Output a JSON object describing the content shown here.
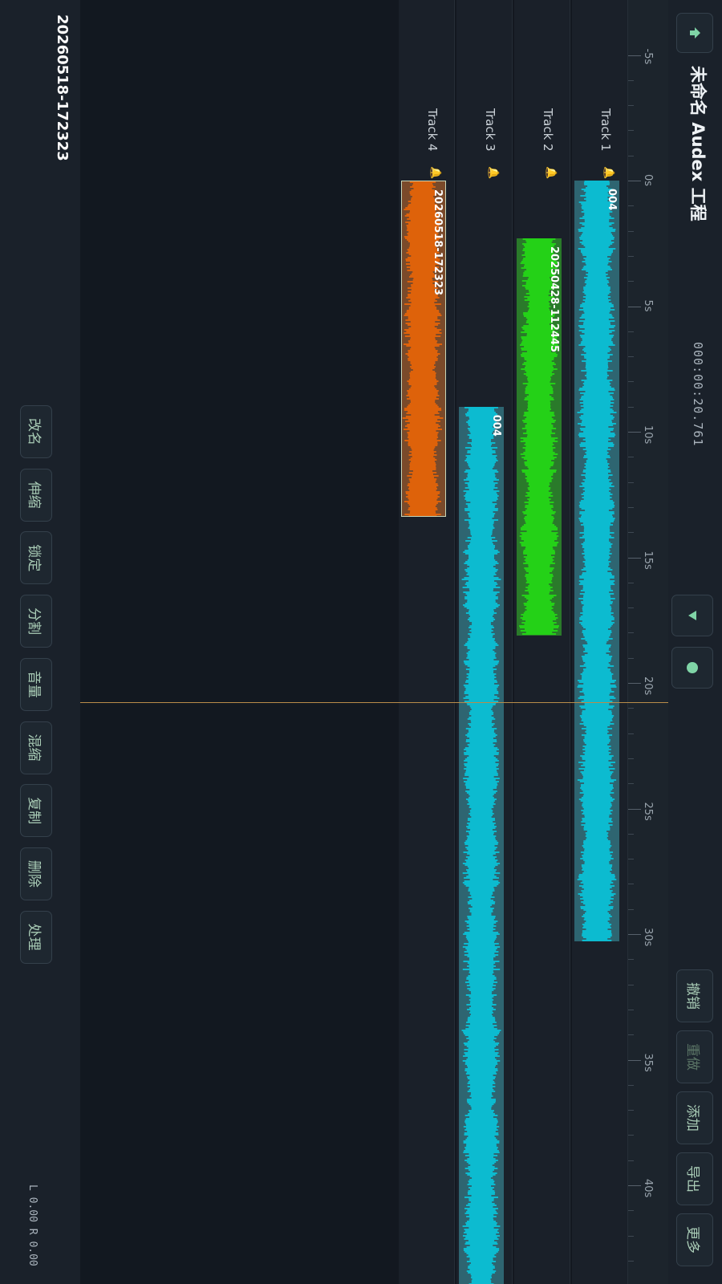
{
  "header": {
    "home_icon": "upload-arrow-icon",
    "title": "未命名 Audex 工程",
    "time": "000:00:20.761",
    "play_icon": "play-icon",
    "record_icon": "record-icon",
    "undo_label": "撤销",
    "redo_label": "重做",
    "add_label": "添加",
    "export_label": "导出",
    "more_label": "更多"
  },
  "ruler": {
    "labels": [
      "-5s",
      "0s",
      "5s",
      "10s",
      "15s",
      "20s",
      "25s",
      "30s",
      "35s",
      "40s"
    ]
  },
  "tracks": [
    {
      "name": "Track 1",
      "icon": "bell-icon",
      "clip": {
        "label": "004",
        "color": "#00d8f0",
        "bg": "#2e6571",
        "start_s": 0,
        "end_s": 30.3
      }
    },
    {
      "name": "Track 2",
      "icon": "bell-icon",
      "clip": {
        "label": "20250428-112445",
        "color": "#22ee11",
        "bg": "#2a7a2a",
        "start_s": 2.3,
        "end_s": 18.1
      }
    },
    {
      "name": "Track 3",
      "icon": "bell-icon",
      "clip": {
        "label": "004",
        "color": "#00d8f0",
        "bg": "#2e6571",
        "start_s": 9.0,
        "end_s": 44.5
      }
    },
    {
      "name": "Track 4",
      "icon": "bell-icon",
      "clip": {
        "label": "20260518-172323",
        "color": "#ff6a00",
        "bg": "#7a4a2a",
        "start_s": 0,
        "end_s": 13.4
      }
    }
  ],
  "playhead_s": 20.761,
  "bottom": {
    "clip_name": "20260518-172323",
    "buttons": [
      "改名",
      "伸缩",
      "锁定",
      "分割",
      "音量",
      "混缩",
      "复制",
      "删除",
      "处理"
    ],
    "levels": "L 0.00  R 0.00"
  },
  "colors": {
    "accent": "#a9ccb6",
    "playhead": "#b98c4a"
  }
}
